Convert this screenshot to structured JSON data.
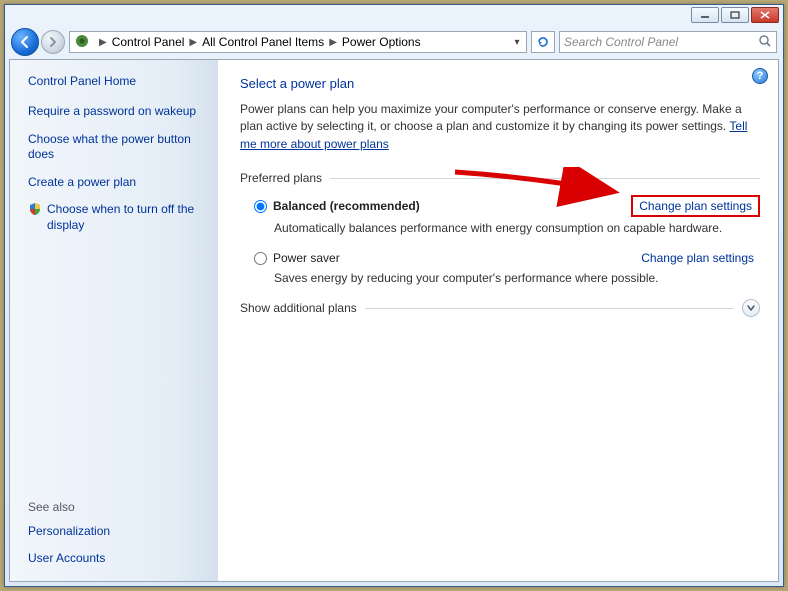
{
  "search": {
    "placeholder": "Search Control Panel"
  },
  "breadcrumb": {
    "items": [
      "Control Panel",
      "All Control Panel Items",
      "Power Options"
    ]
  },
  "sidebar": {
    "home": "Control Panel Home",
    "links": {
      "l1": "Require a password on wakeup",
      "l2": "Choose what the power button does",
      "l3": "Create a power plan",
      "l4": "Choose when to turn off the display"
    },
    "see_also_head": "See also",
    "see_also": {
      "a": "Personalization",
      "b": "User Accounts"
    }
  },
  "page": {
    "title": "Select a power plan",
    "desc1": "Power plans can help you maximize your computer's performance or conserve energy. Make a plan active by selecting it, or choose a plan and customize it by changing its power settings. ",
    "desc_link": "Tell me more about power plans",
    "preferred_head": "Preferred plans",
    "plans": {
      "balanced": {
        "name": "Balanced (recommended)",
        "desc": "Automatically balances performance with energy consumption on capable hardware.",
        "change": "Change plan settings"
      },
      "saver": {
        "name": "Power saver",
        "desc": "Saves energy by reducing your computer's performance where possible.",
        "change": "Change plan settings"
      }
    },
    "additional": "Show additional plans"
  }
}
